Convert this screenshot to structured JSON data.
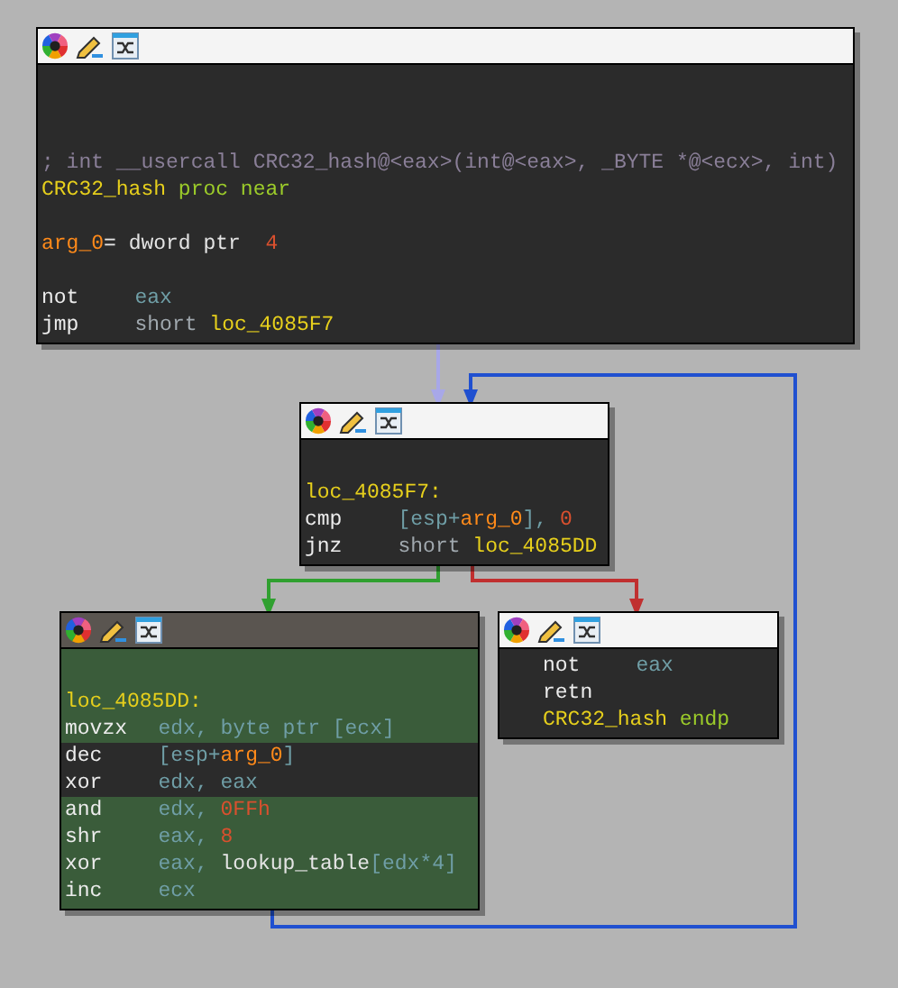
{
  "nodes": [
    {
      "active": false,
      "lines": [
        {
          "highlighted": false,
          "tokens": [
            {
              "text": "; int __usercall CRC32_hash@<eax>(int@<eax>, _BYTE *@<ecx>, int)",
              "kind": "comment"
            }
          ]
        },
        {
          "highlighted": false,
          "tokens": [
            {
              "text": "CRC32_hash",
              "kind": "name"
            },
            {
              "text": " proc near",
              "kind": "keyword"
            }
          ]
        },
        {
          "highlighted": false,
          "tokens": [
            {
              "text": "arg_0",
              "kind": "arg"
            },
            {
              "text": "= dword ptr  ",
              "kind": "plain"
            },
            {
              "text": "4",
              "kind": "num"
            }
          ]
        },
        {
          "highlighted": false,
          "mnemonic": "not",
          "tokens": [
            {
              "text": "eax",
              "kind": "reg"
            }
          ]
        },
        {
          "highlighted": false,
          "mnemonic": "jmp",
          "tokens": [
            {
              "text": "short ",
              "kind": "op"
            },
            {
              "text": "loc_4085F7",
              "kind": "name"
            }
          ]
        }
      ]
    },
    {
      "active": false,
      "lines": [
        {
          "highlighted": false,
          "tokens": [
            {
              "text": "loc_4085F7:",
              "kind": "name"
            }
          ]
        },
        {
          "highlighted": false,
          "mnemonic": "cmp",
          "tokens": [
            {
              "text": "[esp+",
              "kind": "reg"
            },
            {
              "text": "arg_0",
              "kind": "arg"
            },
            {
              "text": "], ",
              "kind": "reg"
            },
            {
              "text": "0",
              "kind": "num"
            }
          ]
        },
        {
          "highlighted": false,
          "mnemonic": "jnz",
          "tokens": [
            {
              "text": "short ",
              "kind": "op"
            },
            {
              "text": "loc_4085DD",
              "kind": "name"
            }
          ]
        }
      ]
    },
    {
      "active": true,
      "lines": [
        {
          "highlighted": true,
          "tokens": [
            {
              "text": "loc_4085DD:",
              "kind": "name"
            }
          ]
        },
        {
          "highlighted": true,
          "mnemonic": "movzx",
          "tokens": [
            {
              "text": "edx, byte ptr [ecx]",
              "kind": "reg"
            }
          ]
        },
        {
          "highlighted": false,
          "mnemonic": "dec",
          "tokens": [
            {
              "text": "[esp+",
              "kind": "reg"
            },
            {
              "text": "arg_0",
              "kind": "arg"
            },
            {
              "text": "]",
              "kind": "reg"
            }
          ]
        },
        {
          "highlighted": false,
          "mnemonic": "xor",
          "tokens": [
            {
              "text": "edx, eax",
              "kind": "reg"
            }
          ]
        },
        {
          "highlighted": true,
          "mnemonic": "and",
          "tokens": [
            {
              "text": "edx, ",
              "kind": "reg"
            },
            {
              "text": "0FFh",
              "kind": "num"
            }
          ]
        },
        {
          "highlighted": true,
          "mnemonic": "shr",
          "tokens": [
            {
              "text": "eax, ",
              "kind": "reg"
            },
            {
              "text": "8",
              "kind": "num"
            }
          ]
        },
        {
          "highlighted": true,
          "mnemonic": "xor",
          "tokens": [
            {
              "text": "eax, ",
              "kind": "reg"
            },
            {
              "text": "lookup_table",
              "kind": "plain"
            },
            {
              "text": "[edx*4]",
              "kind": "reg"
            }
          ]
        },
        {
          "highlighted": true,
          "mnemonic": "inc",
          "tokens": [
            {
              "text": "ecx",
              "kind": "reg"
            }
          ]
        }
      ]
    },
    {
      "active": false,
      "lines": [
        {
          "highlighted": false,
          "mnemonic": "not",
          "tokens": [
            {
              "text": "eax",
              "kind": "reg"
            }
          ]
        },
        {
          "highlighted": false,
          "mnemonic": "retn"
        },
        {
          "highlighted": false,
          "tokens": [
            {
              "text": "CRC32_hash",
              "kind": "name"
            },
            {
              "text": " endp",
              "kind": "keyword"
            }
          ]
        }
      ]
    }
  ],
  "edges": [
    {
      "color": "#a8a8e8"
    },
    {
      "color": "#2050d0"
    },
    {
      "color": "#30a030"
    },
    {
      "color": "#c03030"
    }
  ]
}
